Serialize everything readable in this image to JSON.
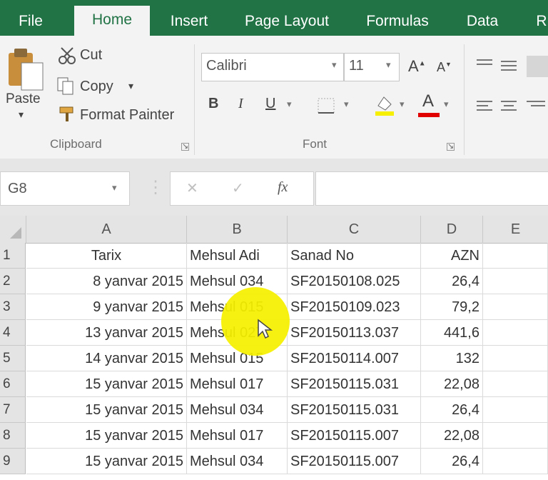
{
  "tabs": [
    "File",
    "Home",
    "Insert",
    "Page Layout",
    "Formulas",
    "Data",
    "R"
  ],
  "active_tab": "Home",
  "clipboard": {
    "paste": "Paste",
    "cut": "Cut",
    "copy": "Copy",
    "format_painter": "Format Painter",
    "group_label": "Clipboard"
  },
  "font": {
    "name": "Calibri",
    "size": "11",
    "grow": "A",
    "shrink": "A",
    "bold": "B",
    "italic": "I",
    "underline": "U",
    "font_color_letter": "A",
    "group_label": "Font"
  },
  "name_box": "G8",
  "formula_icons": {
    "cancel": "✕",
    "enter": "✓",
    "fx": "fx"
  },
  "columns": [
    "A",
    "B",
    "C",
    "D",
    "E"
  ],
  "rows": [
    {
      "n": "1",
      "a": "Tarix",
      "b": "Mehsul Adi",
      "c": "Sanad No",
      "d": "AZN"
    },
    {
      "n": "2",
      "a": "8 yanvar 2015",
      "b": "Mehsul 034",
      "c": "SF20150108.025",
      "d": "26,4"
    },
    {
      "n": "3",
      "a": "9 yanvar 2015",
      "b": "Mehsul 015",
      "c": "SF20150109.023",
      "d": "79,2"
    },
    {
      "n": "4",
      "a": "13 yanvar 2015",
      "b": "Mehsul 027",
      "c": "SF20150113.037",
      "d": "441,6"
    },
    {
      "n": "5",
      "a": "14 yanvar 2015",
      "b": "Mehsul 015",
      "c": "SF20150114.007",
      "d": "132"
    },
    {
      "n": "6",
      "a": "15 yanvar 2015",
      "b": "Mehsul 017",
      "c": "SF20150115.031",
      "d": "22,08"
    },
    {
      "n": "7",
      "a": "15 yanvar 2015",
      "b": "Mehsul 034",
      "c": "SF20150115.031",
      "d": "26,4"
    },
    {
      "n": "8",
      "a": "15 yanvar 2015",
      "b": "Mehsul 017",
      "c": "SF20150115.007",
      "d": "22,08"
    },
    {
      "n": "9",
      "a": "15 yanvar 2015",
      "b": "Mehsul 034",
      "c": "SF20150115.007",
      "d": "26,4"
    }
  ],
  "colors": {
    "brand": "#217346",
    "highlight": "#f6f000",
    "font_color": "#e00000"
  }
}
